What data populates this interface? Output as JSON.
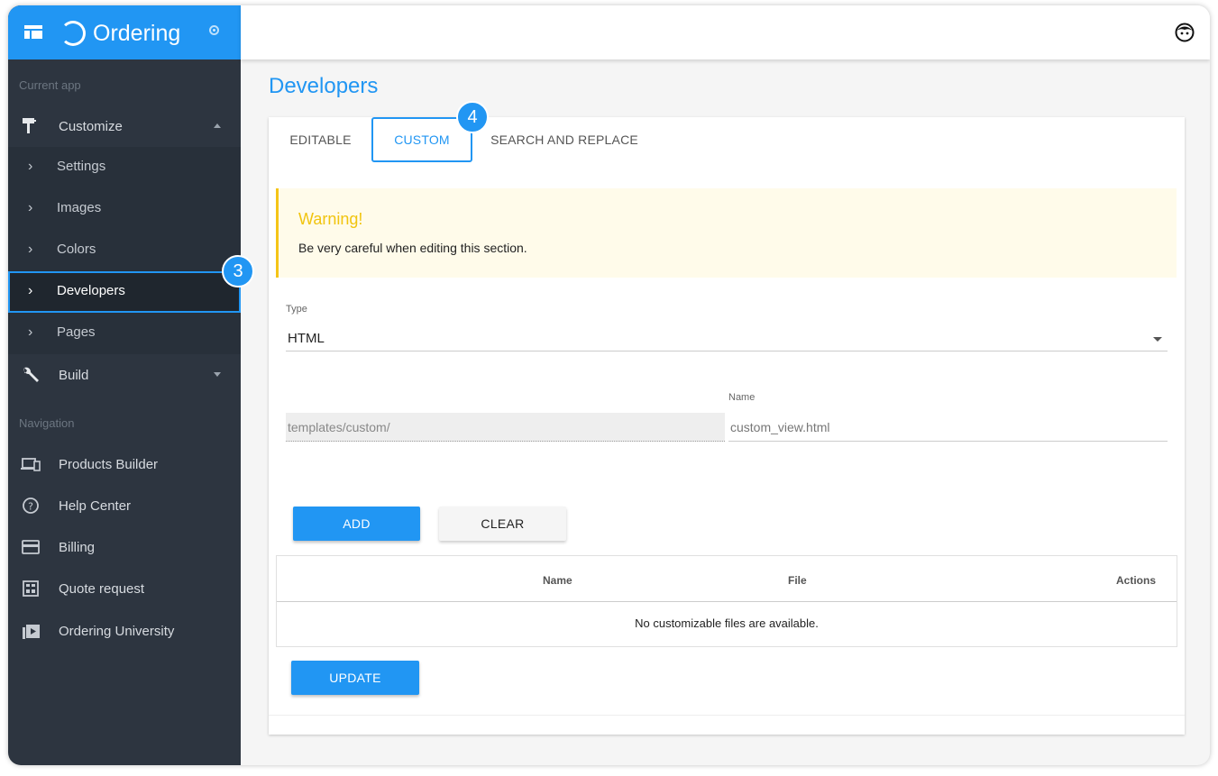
{
  "app": {
    "brand": "Ordering"
  },
  "sidebar": {
    "current_app_label": "Current app",
    "customize": "Customize",
    "sub_items": [
      "Settings",
      "Images",
      "Colors",
      "Developers",
      "Pages"
    ],
    "build": "Build",
    "navigation_label": "Navigation",
    "nav_items": [
      "Products Builder",
      "Help Center",
      "Billing",
      "Quote request",
      "Ordering University"
    ]
  },
  "annotations": {
    "step3": "3",
    "step4": "4"
  },
  "page": {
    "title": "Developers"
  },
  "tabs": [
    "EDITABLE",
    "CUSTOM",
    "SEARCH AND REPLACE"
  ],
  "warning": {
    "title": "Warning!",
    "text": "Be very careful when editing this section."
  },
  "form": {
    "type_label": "Type",
    "type_value": "HTML",
    "prefix_value": "templates/custom/",
    "name_label": "Name",
    "name_value": "custom_view.html",
    "add_label": "ADD",
    "clear_label": "CLEAR"
  },
  "table": {
    "headers": [
      "Name",
      "File",
      "Actions"
    ],
    "empty_text": "No customizable files are available."
  },
  "update_label": "UPDATE",
  "colors": {
    "accent": "#2196f3",
    "sidebar": "#2d3540",
    "warning": "#f1c40f"
  }
}
